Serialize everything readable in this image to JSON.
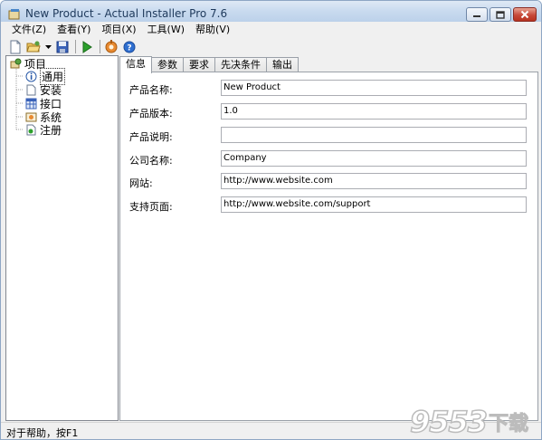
{
  "window": {
    "title": "New Product - Actual Installer Pro 7.6"
  },
  "menu": [
    {
      "label": "文件(Z)"
    },
    {
      "label": "查看(Y)"
    },
    {
      "label": "项目(X)"
    },
    {
      "label": "工具(W)"
    },
    {
      "label": "帮助(V)"
    }
  ],
  "toolbar": {
    "icons": [
      "new-file-icon",
      "open-folder-icon",
      "dropdown-arrow-icon",
      "save-icon",
      "run-icon",
      "settings-icon",
      "help-icon"
    ]
  },
  "tree": {
    "root": "项目",
    "items": [
      {
        "label": "通用",
        "icon": "info-icon"
      },
      {
        "label": "安装",
        "icon": "page-icon"
      },
      {
        "label": "接口",
        "icon": "grid-icon"
      },
      {
        "label": "系统",
        "icon": "system-icon"
      },
      {
        "label": "注册",
        "icon": "register-icon"
      }
    ]
  },
  "tabs": [
    {
      "label": "信息",
      "active": true
    },
    {
      "label": "参数"
    },
    {
      "label": "要求"
    },
    {
      "label": "先决条件"
    },
    {
      "label": "输出"
    }
  ],
  "fields": [
    {
      "label": "产品名称:",
      "value": "New Product"
    },
    {
      "label": "产品版本:",
      "value": "1.0"
    },
    {
      "label": "产品说明:",
      "value": ""
    },
    {
      "label": "公司名称:",
      "value": "Company"
    },
    {
      "label": "网站:",
      "value": "http://www.website.com"
    },
    {
      "label": "支持页面:",
      "value": "http://www.website.com/support"
    }
  ],
  "status": {
    "text": "对于帮助，按F1"
  },
  "watermark": {
    "number": "9553",
    "text": "下载"
  }
}
